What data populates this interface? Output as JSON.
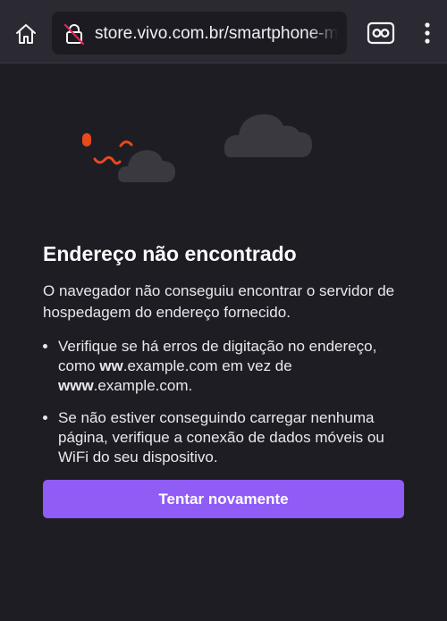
{
  "toolbar": {
    "url": "store.vivo.com.br/smartphone-motorola-edge",
    "icons": [
      "home-icon",
      "insecure-lock-icon",
      "reader-mode-icon",
      "overflow-menu-icon"
    ]
  },
  "error": {
    "title": "Endereço não encontrado",
    "description": "O navegador não conseguiu encontrar o servidor de hospedagem do endereço fornecido.",
    "tip1": {
      "pre": "Verifique se há erros de digitação no endereço, como ",
      "bold1": "ww",
      "mid": ".example.com em vez de ",
      "bold2": "www",
      "post": ".example.com."
    },
    "tip2": "Se não estiver conseguindo carregar nenhuma página, verifique a conexão de dados móveis ou WiFi do seu dispositivo.",
    "button_label": "Tentar novamente"
  },
  "colors": {
    "background": "#1f1d24",
    "toolbar": "#2b2a33",
    "accent_button": "#8f5cf6",
    "illustration_orange": "#e8491d",
    "cloud": "#3a3940"
  }
}
